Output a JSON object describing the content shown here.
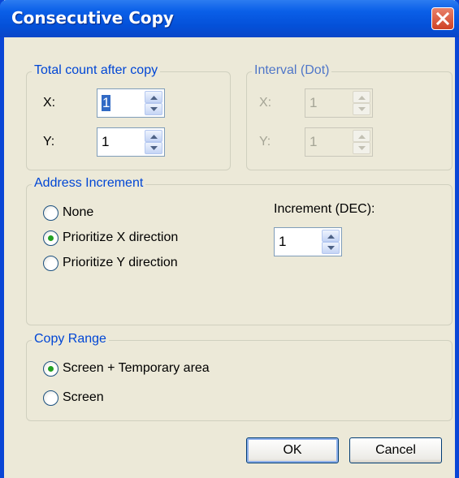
{
  "window": {
    "title": "Consecutive Copy"
  },
  "total_count": {
    "legend": "Total count after copy",
    "x_label": "X:",
    "x_value": "1",
    "y_label": "Y:",
    "y_value": "1"
  },
  "interval": {
    "legend": "Interval (Dot)",
    "x_label": "X:",
    "x_value": "1",
    "y_label": "Y:",
    "y_value": "1"
  },
  "address_increment": {
    "legend": "Address Increment",
    "options": [
      {
        "label": "None",
        "selected": false
      },
      {
        "label": "Prioritize X direction",
        "selected": true
      },
      {
        "label": "Prioritize Y direction",
        "selected": false
      }
    ],
    "increment_label": "Increment (DEC):",
    "increment_value": "1"
  },
  "copy_range": {
    "legend": "Copy Range",
    "options": [
      {
        "label": "Screen + Temporary area",
        "selected": true
      },
      {
        "label": "Screen",
        "selected": false
      }
    ]
  },
  "buttons": {
    "ok": "OK",
    "cancel": "Cancel"
  },
  "colors": {
    "title_bar": "#0a5fe8",
    "group_legend": "#0046d5",
    "radio_selected": "#21a121",
    "close_button": "#cf4225"
  }
}
